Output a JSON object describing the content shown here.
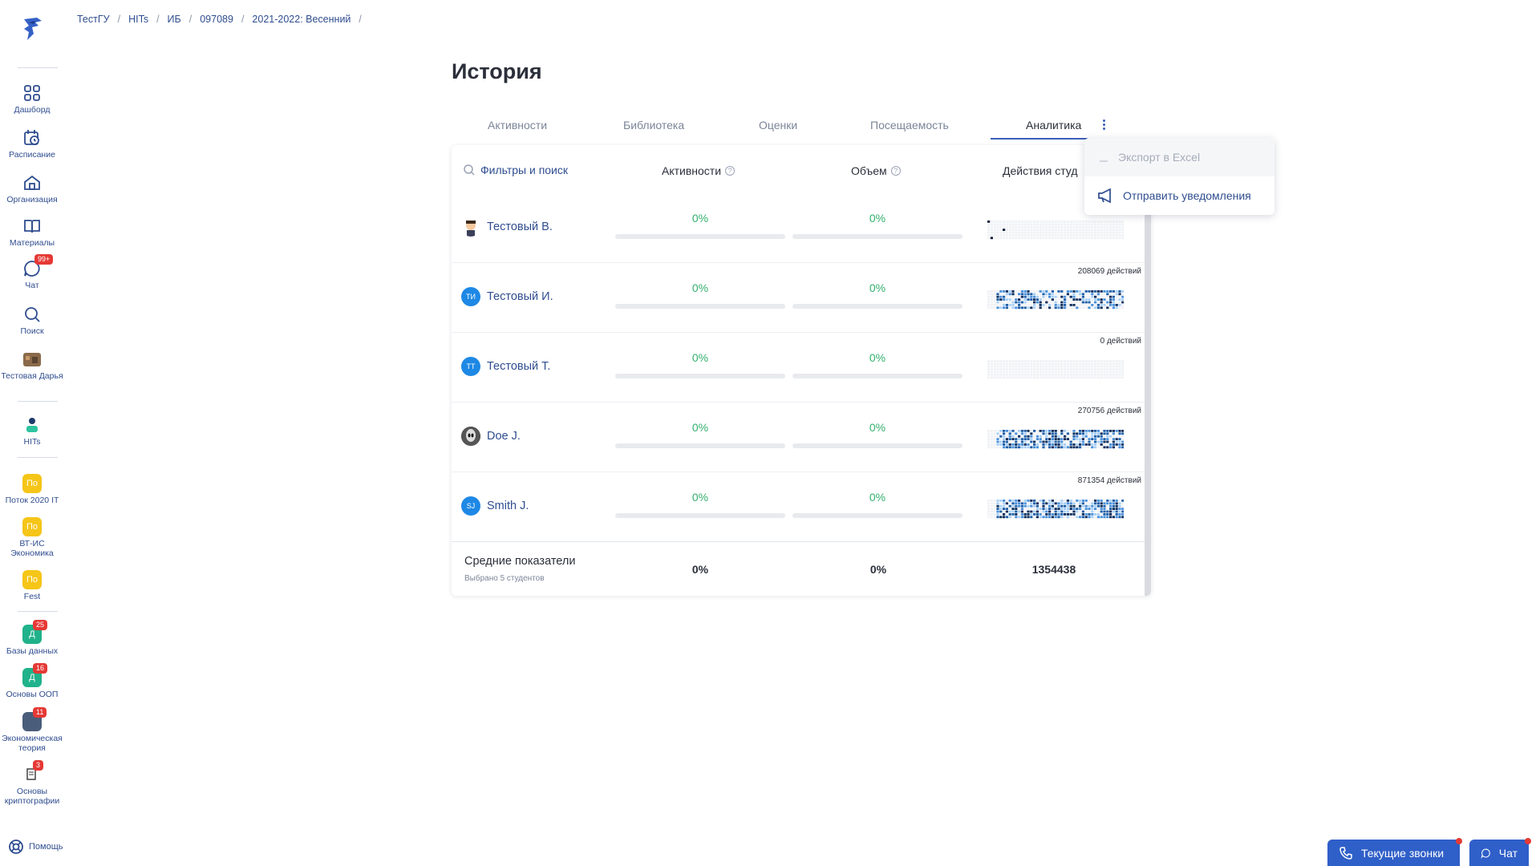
{
  "breadcrumb": [
    "ТестГУ",
    "HITs",
    "ИБ",
    "097089",
    "2021-2022: Весенний"
  ],
  "page_title": "История",
  "tabs": [
    {
      "label": "Активности"
    },
    {
      "label": "Библиотека"
    },
    {
      "label": "Оценки"
    },
    {
      "label": "Посещаемость"
    },
    {
      "label": "Аналитика",
      "active": true
    }
  ],
  "sidebar": {
    "items": [
      {
        "label": "Дашборд",
        "icon": "grid-icon"
      },
      {
        "label": "Расписание",
        "icon": "calendar-clock-icon"
      },
      {
        "label": "Организация",
        "icon": "home-icon"
      },
      {
        "label": "Материалы",
        "icon": "book-icon"
      },
      {
        "label": "Чат",
        "icon": "chat-icon",
        "badge": "99+"
      },
      {
        "label": "Поиск",
        "icon": "search-icon"
      },
      {
        "label": "Тестовая Дарья",
        "icon": "user-avatar"
      },
      {
        "label": "HITs",
        "icon": "hits-logo"
      }
    ],
    "groups": [
      {
        "label": "Поток 2020 IT",
        "abbr": "По",
        "color": "#f5c518"
      },
      {
        "label": "ВТ-ИС Экономика",
        "abbr": "По",
        "color": "#f5c518"
      },
      {
        "label": "Fest",
        "abbr": "По",
        "color": "#f5c518"
      },
      {
        "label": "Базы данных",
        "abbr": "Д",
        "color": "#20b28a",
        "badge": "25"
      },
      {
        "label": "Основы ООП",
        "abbr": "Д",
        "color": "#20b28a",
        "badge": "16"
      },
      {
        "label": "Экономическая теория",
        "abbr": "",
        "color": "#4a5d7a",
        "badge": "11"
      },
      {
        "label": "Основы криптографии",
        "abbr": "",
        "color": "#ffffff",
        "badge": "3"
      }
    ],
    "help_label": "Помощь"
  },
  "table": {
    "search_placeholder": "Фильтры и поиск",
    "columns": {
      "activities": "Активности",
      "volume": "Объем",
      "actions": "Действия студ"
    },
    "rows": [
      {
        "name": "Тестовый В.",
        "initials": "",
        "avatar_color": "#ffffff",
        "activities": "0%",
        "volume": "0%",
        "activities_fraction": 0,
        "volume_fraction": 0,
        "actions": "",
        "density": 0.05,
        "dark": true
      },
      {
        "name": "Тестовый И.",
        "initials": "ТИ",
        "avatar_color": "#1e88e5",
        "activities": "0%",
        "volume": "0%",
        "activities_fraction": 0,
        "volume_fraction": 0,
        "actions": "208069 действий",
        "density": 0.6,
        "dark": false
      },
      {
        "name": "Тестовый Т.",
        "initials": "ТТ",
        "avatar_color": "#1e88e5",
        "activities": "0%",
        "volume": "0%",
        "activities_fraction": 0,
        "volume_fraction": 0,
        "actions": "0 действий",
        "density": 0,
        "dark": false
      },
      {
        "name": "Doe J.",
        "initials": "",
        "avatar_color": "#3a3a3a",
        "activities": "0%",
        "volume": "0%",
        "activities_fraction": 0,
        "volume_fraction": 0,
        "actions": "270756 действий",
        "density": 0.7,
        "dark": false
      },
      {
        "name": "Smith J.",
        "initials": "SJ",
        "avatar_color": "#1e88e5",
        "activities": "0%",
        "volume": "0%",
        "activities_fraction": 0,
        "volume_fraction": 0,
        "actions": "871354 действий",
        "density": 0.8,
        "dark": false
      }
    ],
    "footer": {
      "label": "Средние показатели",
      "sub": "Выбрано 5 студентов",
      "activities": "0%",
      "volume": "0%",
      "actions": "1354438"
    }
  },
  "dropdown": {
    "export": "Экспорт в Excel",
    "notify": "Отправить уведомления"
  },
  "bottom": {
    "calls": "Текущие звонки",
    "chat": "Чат"
  },
  "colors": {
    "accent": "#2f5fc8",
    "success": "#33b06e",
    "link": "#2f4d8f"
  }
}
